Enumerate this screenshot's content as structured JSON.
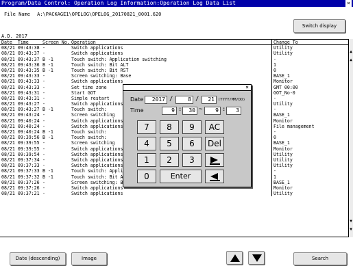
{
  "window": {
    "title": "Program/Data Control: Operation Log Information:Operation Log Data List",
    "close_glyph": "×"
  },
  "file": {
    "label": "File Name",
    "path": "A:\\PACKAGE1\\OPELOG\\OPELOG_20170821_0001.620"
  },
  "buttons": {
    "switch_display": "Switch display",
    "date_descending": "Date (descending)",
    "image": "Image",
    "search": "Search"
  },
  "era": "A.D. 2017",
  "columns": {
    "date": "Date",
    "time": "Time",
    "screen_no": "Screen No.",
    "operation": "Operation",
    "change_to": "Change To"
  },
  "rows": [
    {
      "dt": "08/21 09:43:38",
      "sn": "-",
      "op": "Switch applications",
      "ct": "Utility"
    },
    {
      "dt": "08/21 09:43:37",
      "sn": "-",
      "op": "Switch applications",
      "ct": "Utility"
    },
    {
      "dt": "08/21 09:43:37",
      "sn": "B -1",
      "op": "Touch switch: Application switching",
      "ct": "-"
    },
    {
      "dt": "08/21 09:43:36",
      "sn": "B -1",
      "op": "Touch switch: Bit ALT",
      "ct": "1"
    },
    {
      "dt": "08/21 09:43:35",
      "sn": "B -1",
      "op": "Touch switch: Bit RST",
      "ct": "0"
    },
    {
      "dt": "08/21 09:43:33",
      "sn": "-",
      "op": "Screen switching: Base",
      "ct": "BASE_1"
    },
    {
      "dt": "08/21 09:43:33",
      "sn": "-",
      "op": "Switch applications",
      "ct": "Monitor"
    },
    {
      "dt": "08/21 09:43:33",
      "sn": "-",
      "op": "Set time zone",
      "ct": "GMT 00:00"
    },
    {
      "dt": "08/21 09:43:31",
      "sn": "-",
      "op": "Start GOT",
      "ct": "GOT_No-0"
    },
    {
      "dt": "08/21 09:43:31",
      "sn": "-",
      "op": "Simple restart",
      "ct": "-"
    },
    {
      "dt": "08/21 09:43:27",
      "sn": "-",
      "op": "Switch applications",
      "ct": "Utility"
    },
    {
      "dt": "08/21 09:43:27",
      "sn": "B -1",
      "op": "Touch switch:",
      "ct": "-"
    },
    {
      "dt": "08/21 09:43:24",
      "sn": "-",
      "op": "Screen switching",
      "ct": "BASE_1"
    },
    {
      "dt": "08/21 09:40:24",
      "sn": "-",
      "op": "Switch applications",
      "ct": "Monitor"
    },
    {
      "dt": "08/21 09:40:24",
      "sn": "-",
      "op": "Switch applications",
      "ct": "File management"
    },
    {
      "dt": "08/21 09:40:24",
      "sn": "B -1",
      "op": "Touch switch:",
      "ct": "-"
    },
    {
      "dt": "08/21 09:39:56",
      "sn": "B -1",
      "op": "Touch switch:",
      "ct": "0"
    },
    {
      "dt": "08/21 09:39:55",
      "sn": "-",
      "op": "Screen switching",
      "ct": "BASE_1"
    },
    {
      "dt": "08/21 09:39:55",
      "sn": "-",
      "op": "Switch applications",
      "ct": "Monitor"
    },
    {
      "dt": "08/21 09:39:54",
      "sn": "-",
      "op": "Switch applications",
      "ct": "Utility"
    },
    {
      "dt": "08/21 09:37:34",
      "sn": "-",
      "op": "Switch applications",
      "ct": "Utility"
    },
    {
      "dt": "08/21 09:37:33",
      "sn": "-",
      "op": "Switch applications",
      "ct": "Utility"
    },
    {
      "dt": "08/21 09:37:33",
      "sn": "B -1",
      "op": "Touch switch: Application switching",
      "ct": "-"
    },
    {
      "dt": "08/21 09:37:32",
      "sn": "B -1",
      "op": "Touch switch: Bit ALT",
      "ct": "1"
    },
    {
      "dt": "08/21 09:37:26",
      "sn": "-",
      "op": "Screen switching: Base",
      "ct": "BASE_1"
    },
    {
      "dt": "08/21 09:37:26",
      "sn": "-",
      "op": "Switch applications",
      "ct": "Monitor"
    },
    {
      "dt": "08/21 09:37:21",
      "sn": "-",
      "op": "Switch applications",
      "ct": "Utility"
    }
  ],
  "dialog": {
    "close_glyph": "×",
    "date_label": "Date",
    "year": "2017",
    "month": "8",
    "day": "21",
    "date_sep": "/",
    "date_format": "(YYYY/MM/DD)",
    "time_label": "Time",
    "time_from_h": "9",
    "time_from_m": "30",
    "time_tilde": "~",
    "time_to_h": "9",
    "time_to_m": "3",
    "time_sep": ":",
    "keys": {
      "k7": "7",
      "k8": "8",
      "k9": "9",
      "ac": "AC",
      "k4": "4",
      "k5": "5",
      "k6": "6",
      "del": "Del",
      "k1": "1",
      "k2": "2",
      "k3": "3",
      "k0": "0",
      "enter": "Enter"
    }
  },
  "colors": {
    "title_bar": "#0000a8",
    "button_face": "#e6e6e6",
    "dialog_face": "#c8c8c8"
  }
}
